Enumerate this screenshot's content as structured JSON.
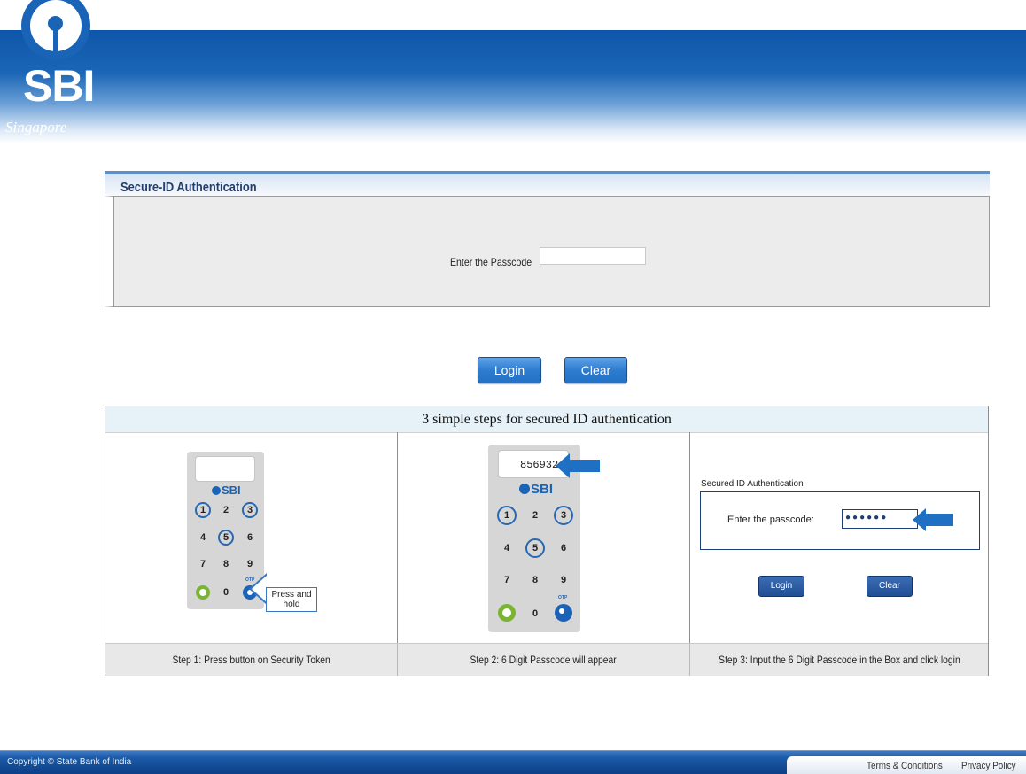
{
  "header": {
    "logo_text": "SBI",
    "logo_sub": "Singapore",
    "logo_icon": "sbi-keyhole-logo",
    "brand_color": "#1a64b8"
  },
  "auth_panel": {
    "title": "Secure-ID Authentication",
    "passcode_label": "Enter the Passcode",
    "passcode_value": "",
    "passcode_placeholder": ""
  },
  "actions": {
    "login_label": "Login",
    "clear_label": "Clear"
  },
  "steps": {
    "heading": "3 simple steps for secured ID authentication",
    "step1": {
      "caption": "Step 1: Press button on Security Token",
      "token_brand": "SBI",
      "callout": "Press and hold",
      "otp_label": "OTP",
      "keys": [
        "1",
        "2",
        "3",
        "4",
        "5",
        "6",
        "7",
        "8",
        "9",
        "0"
      ]
    },
    "step2": {
      "caption": "Step 2: 6 Digit Passcode will appear",
      "token_brand": "SBI",
      "screen_value": "856932",
      "otp_label": "OTP",
      "keys": [
        "1",
        "2",
        "3",
        "4",
        "5",
        "6",
        "7",
        "8",
        "9",
        "0"
      ]
    },
    "step3": {
      "caption": "Step 3: Input the 6 Digit Passcode in the Box and click login",
      "mini_title": "Secured ID Authentication",
      "mini_label": "Enter the passcode:",
      "mini_value": "●●●●●●",
      "mini_login": "Login",
      "mini_clear": "Clear"
    }
  },
  "footer": {
    "copyright": "Copyright © State Bank of India",
    "terms": "Terms & Conditions",
    "privacy": "Privacy Policy"
  }
}
